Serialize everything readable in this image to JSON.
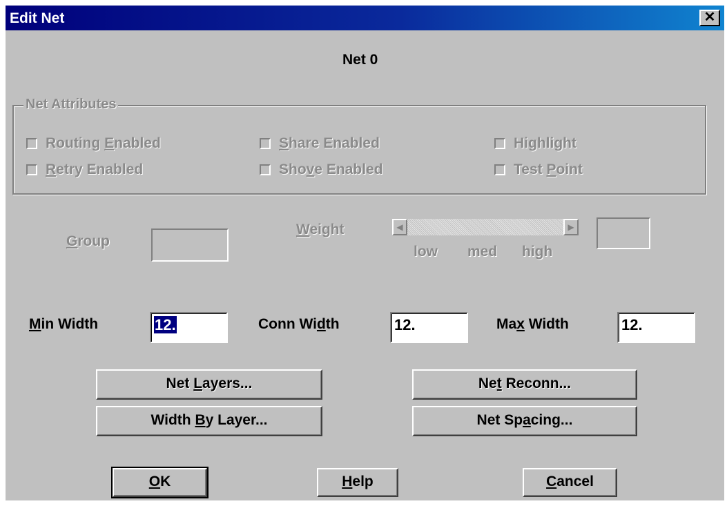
{
  "window": {
    "title": "Edit Net",
    "close_glyph": "✕"
  },
  "net_name": "Net 0",
  "attributes": {
    "legend": "Net Attributes",
    "routing_enabled": {
      "pre": "Routing ",
      "key": "E",
      "post": "nabled"
    },
    "retry_enabled": {
      "pre": "",
      "key": "R",
      "post": "etry Enabled"
    },
    "share_enabled": {
      "pre": "",
      "key": "S",
      "post": "hare Enabled"
    },
    "shove_enabled": {
      "pre": "Sho",
      "key": "v",
      "post": "e Enabled"
    },
    "highlight": {
      "pre": "Highlight",
      "key": "",
      "post": ""
    },
    "test_point": {
      "pre": "Test ",
      "key": "P",
      "post": "oint"
    }
  },
  "group": {
    "pre": "",
    "key": "G",
    "post": "roup",
    "value": ""
  },
  "weight": {
    "pre": "",
    "key": "W",
    "post": "eight",
    "scale": [
      "low",
      "med",
      "high"
    ],
    "value": ""
  },
  "min_width": {
    "pre": "",
    "key": "M",
    "post": "in Width",
    "value": "12."
  },
  "conn_width": {
    "pre": "Conn Wi",
    "key": "d",
    "post": "th",
    "value": "12."
  },
  "max_width": {
    "pre": "Ma",
    "key": "x",
    "post": " Width",
    "value": "12."
  },
  "buttons": {
    "net_layers": {
      "pre": "Net ",
      "key": "L",
      "post": "ayers..."
    },
    "net_reconn": {
      "pre": "Ne",
      "key": "t",
      "post": " Reconn..."
    },
    "width_by_layer": {
      "pre": "Width ",
      "key": "B",
      "post": "y Layer..."
    },
    "net_spacing": {
      "pre": "Net Sp",
      "key": "a",
      "post": "cing..."
    },
    "ok": {
      "pre": "",
      "key": "O",
      "post": "K"
    },
    "help": {
      "pre": "",
      "key": "H",
      "post": "elp"
    },
    "cancel": {
      "pre": "",
      "key": "C",
      "post": "ancel"
    }
  },
  "icons": {
    "close": "close-icon",
    "scroll_left": "arrow-left-icon",
    "scroll_right": "arrow-right-icon"
  }
}
